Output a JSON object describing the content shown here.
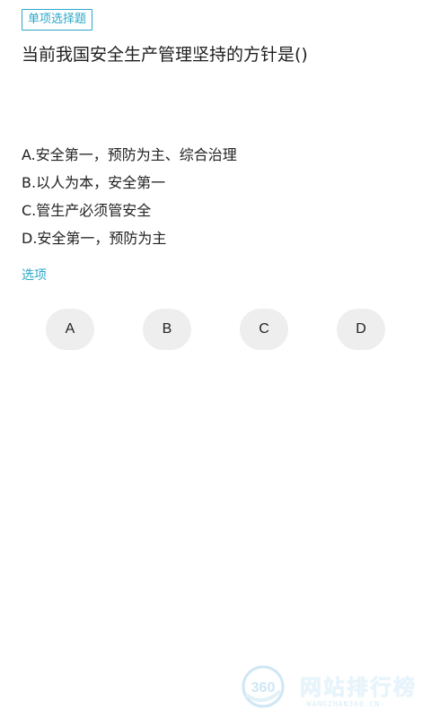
{
  "question": {
    "type_tag": "单项选择题",
    "text": "当前我国安全生产管理坚持的方针是()",
    "options": [
      "A.安全第一，预防为主、综合治理",
      "B.以人为本，安全第一",
      "C.管生产必须管安全",
      "D.安全第一，预防为主"
    ]
  },
  "answer_section": {
    "label": "选项",
    "buttons": [
      "A",
      "B",
      "C",
      "D"
    ]
  },
  "watermark": {
    "logo_text": "360",
    "title": "网站排行榜",
    "subtitle": "-WANGZHAN360.CN-"
  },
  "colors": {
    "accent": "#2aa7c9",
    "button_bg": "#eeeeee",
    "text": "#222222"
  }
}
